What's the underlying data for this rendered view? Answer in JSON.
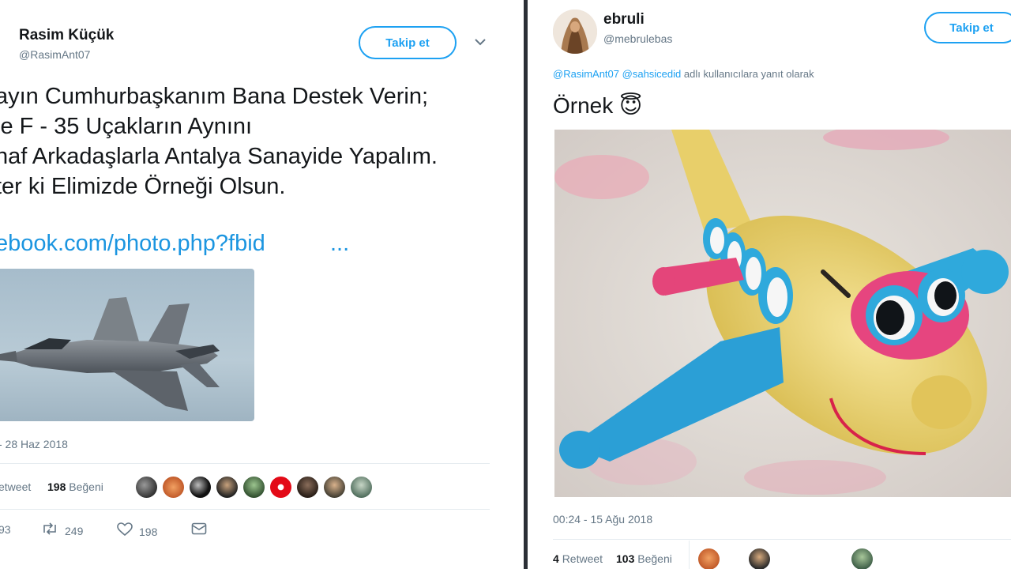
{
  "left_tweet": {
    "display_name": "Rasim Küçük",
    "handle": "@RasimAnt07",
    "follow_label": "Takip et",
    "text_lines": [
      "ayın Cumhurbaşkanım Bana Destek Verin;",
      "le F - 35 Uçakların Aynını",
      "naf Arkadaşlarla Antalya Sanayide Yapalım.",
      "ter ki Elimizde Örneği Olsun."
    ],
    "link_text": "ebook.com/photo.php?fbid",
    "link_ellipsis": "...",
    "timestamp": "- 28 Haz 2018",
    "retweet_label": "etweet",
    "likes_count": "198",
    "likes_label": "Beğeni",
    "actions": {
      "reply_count": "93",
      "retweet_count": "249",
      "like_count": "198"
    }
  },
  "right_tweet": {
    "display_name": "ebruli",
    "handle": "@mebrulebas",
    "follow_label": "Takip et",
    "reply_mention_1": "@RasimAnt07",
    "reply_mention_2": "@sahsicedid",
    "reply_suffix": "adlı kullanıcılara yanıt olarak",
    "text": "Örnek",
    "emoji": "😇",
    "timestamp": "00:24 - 15 Ağu 2018",
    "retweet_count": "4",
    "retweet_label": "Retweet",
    "likes_count": "103",
    "likes_label": "Beğeni"
  },
  "colors": {
    "accent": "#1da1f2",
    "link": "#1b95e0",
    "muted": "#657786"
  }
}
